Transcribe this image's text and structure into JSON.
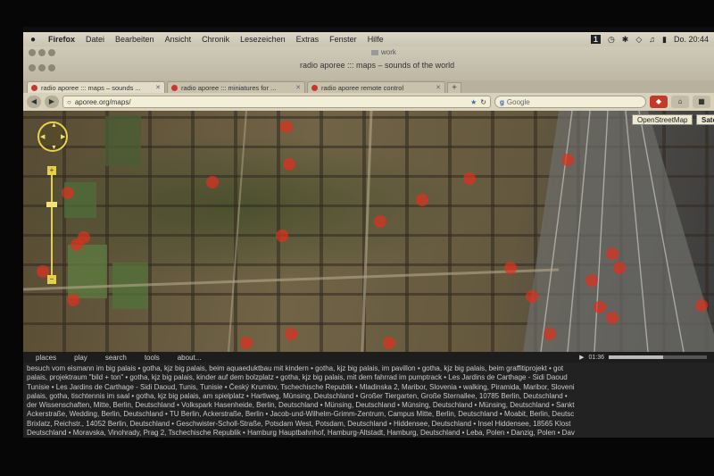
{
  "menubar": {
    "app": "Firefox",
    "items": [
      "Datei",
      "Bearbeiten",
      "Ansicht",
      "Chronik",
      "Lesezeichen",
      "Extras",
      "Fenster",
      "Hilfe"
    ],
    "status_badge": "1",
    "clock": "Do. 20:44"
  },
  "window": {
    "workspace_label": "work",
    "title": "radio aporee ::: maps – sounds of the world"
  },
  "tabs": [
    {
      "label": "radio aporee ::: maps – sounds ...",
      "active": true
    },
    {
      "label": "radio aporee ::: miniatures for ...",
      "active": false
    },
    {
      "label": "radio aporee remote control",
      "active": false
    }
  ],
  "navbar": {
    "url": "aporee.org/maps/",
    "search_placeholder": "Google"
  },
  "map": {
    "types": [
      "OpenStreetMap",
      "Sate"
    ],
    "selected_type": "Sate",
    "pin_color": "#e0301e"
  },
  "bottombar": {
    "nav": [
      "places",
      "play",
      "search",
      "tools",
      "about..."
    ],
    "time": "01:36",
    "progress": 0.55
  },
  "info_lines": [
    "besuch vom eismann im big palais • gotha, kjz big palais, beim aquaeduktbau mit kindern • gotha, kjz big palais, im pavillon • gotha, kjz big palais, beim graffitiprojekt • got",
    "palais, projektraum \"bild + ton\" • gotha, kjz big palais, kinder auf dem bolzplatz • gotha, kjz big palais, mit dem fahrrad im pumptrack • Les Jardins de Carthage - Sidi Daoud",
    "Tunisie • Les Jardins de Carthage - Sidi Daoud, Tunis, Tunisie • Český Krumlov, Tschechische Republik • Mladinska 2, Maribor, Slovenia • walking, Piramida, Maribor, Sloveni",
    "palais, gotha, tischtennis im saal • gotha, kjz big palais, am spielplatz • Hartlweg, Münsing, Deutschland • Großer Tiergarten, Große Sternallee, 10785 Berlin, Deutschland •",
    "der Wissenschaften, Mitte, Berlin, Deutschland • Volkspark Hasenheide, Berlin, Deutschland • Münsing, Deutschland • Münsing, Deutschland • Münsing, Deutschland • Sankt",
    "Ackerstraße, Wedding, Berlin, Deutschland • TU Berlin, Ackerstraße, Berlin • Jacob-und-Wilhelm-Grimm-Zentrum, Campus Mitte, Berlin, Deutschland • Moabit, Berlin, Deutsc",
    "Brixlatz, Reichstr., 14052 Berlin, Deutschland • Geschwister-Scholl-Straße, Potsdam West, Potsdam, Deutschland • Hiddensee, Deutschland • Insel Hiddensee, 18565 Klost",
    "Deutschland • Moravska, Vinohrady, Prag 2, Tschechische Republik • Hamburg Hauptbahnhof, Hamburg-Altstadt, Hamburg, Deutschland • Leba, Polen • Danzig, Polen • Dav"
  ]
}
